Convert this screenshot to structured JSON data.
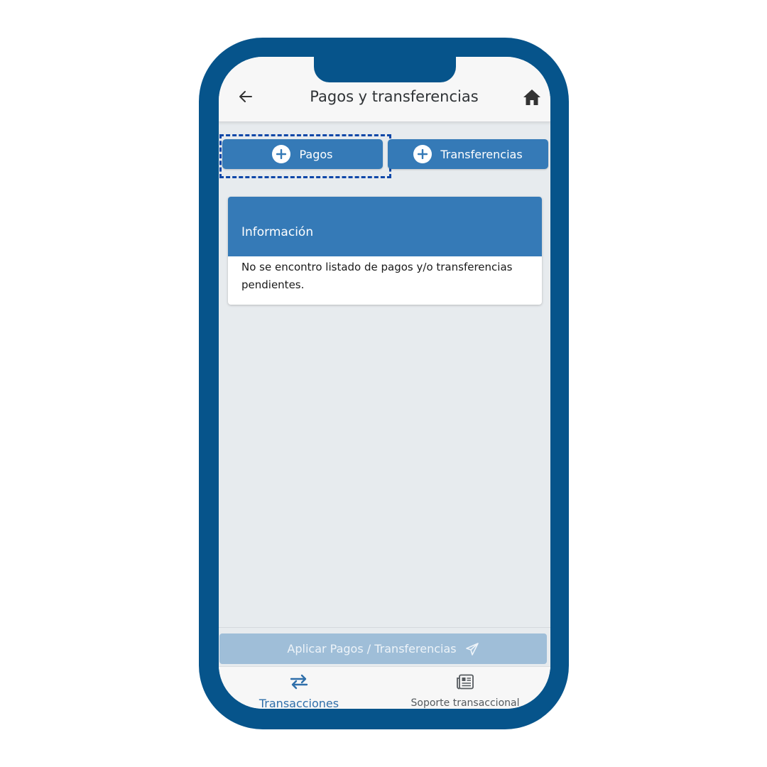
{
  "header": {
    "title": "Pagos y transferencias",
    "back_icon": "arrow-left-icon",
    "home_icon": "home-icon"
  },
  "actions": {
    "pagos_label": "Pagos",
    "transferencias_label": "Transferencias",
    "plus_icon": "plus-circle-icon"
  },
  "info_card": {
    "title": "Información",
    "message": "No se encontro listado de pagos y/o transferencias pendientes."
  },
  "apply": {
    "label": "Aplicar Pagos / Transferencias",
    "icon": "send-icon",
    "enabled": false
  },
  "bottom_nav": {
    "items": [
      {
        "label": "Transacciones",
        "icon": "transfer-arrows-icon",
        "active": true
      },
      {
        "label": "Soporte transaccional",
        "icon": "newspaper-icon",
        "active": false
      }
    ]
  },
  "colors": {
    "frame": "#06548b",
    "primary": "#357ab7",
    "disabled": "#9fbed8",
    "focus": "#0d47a8",
    "background": "#e7ebee"
  }
}
